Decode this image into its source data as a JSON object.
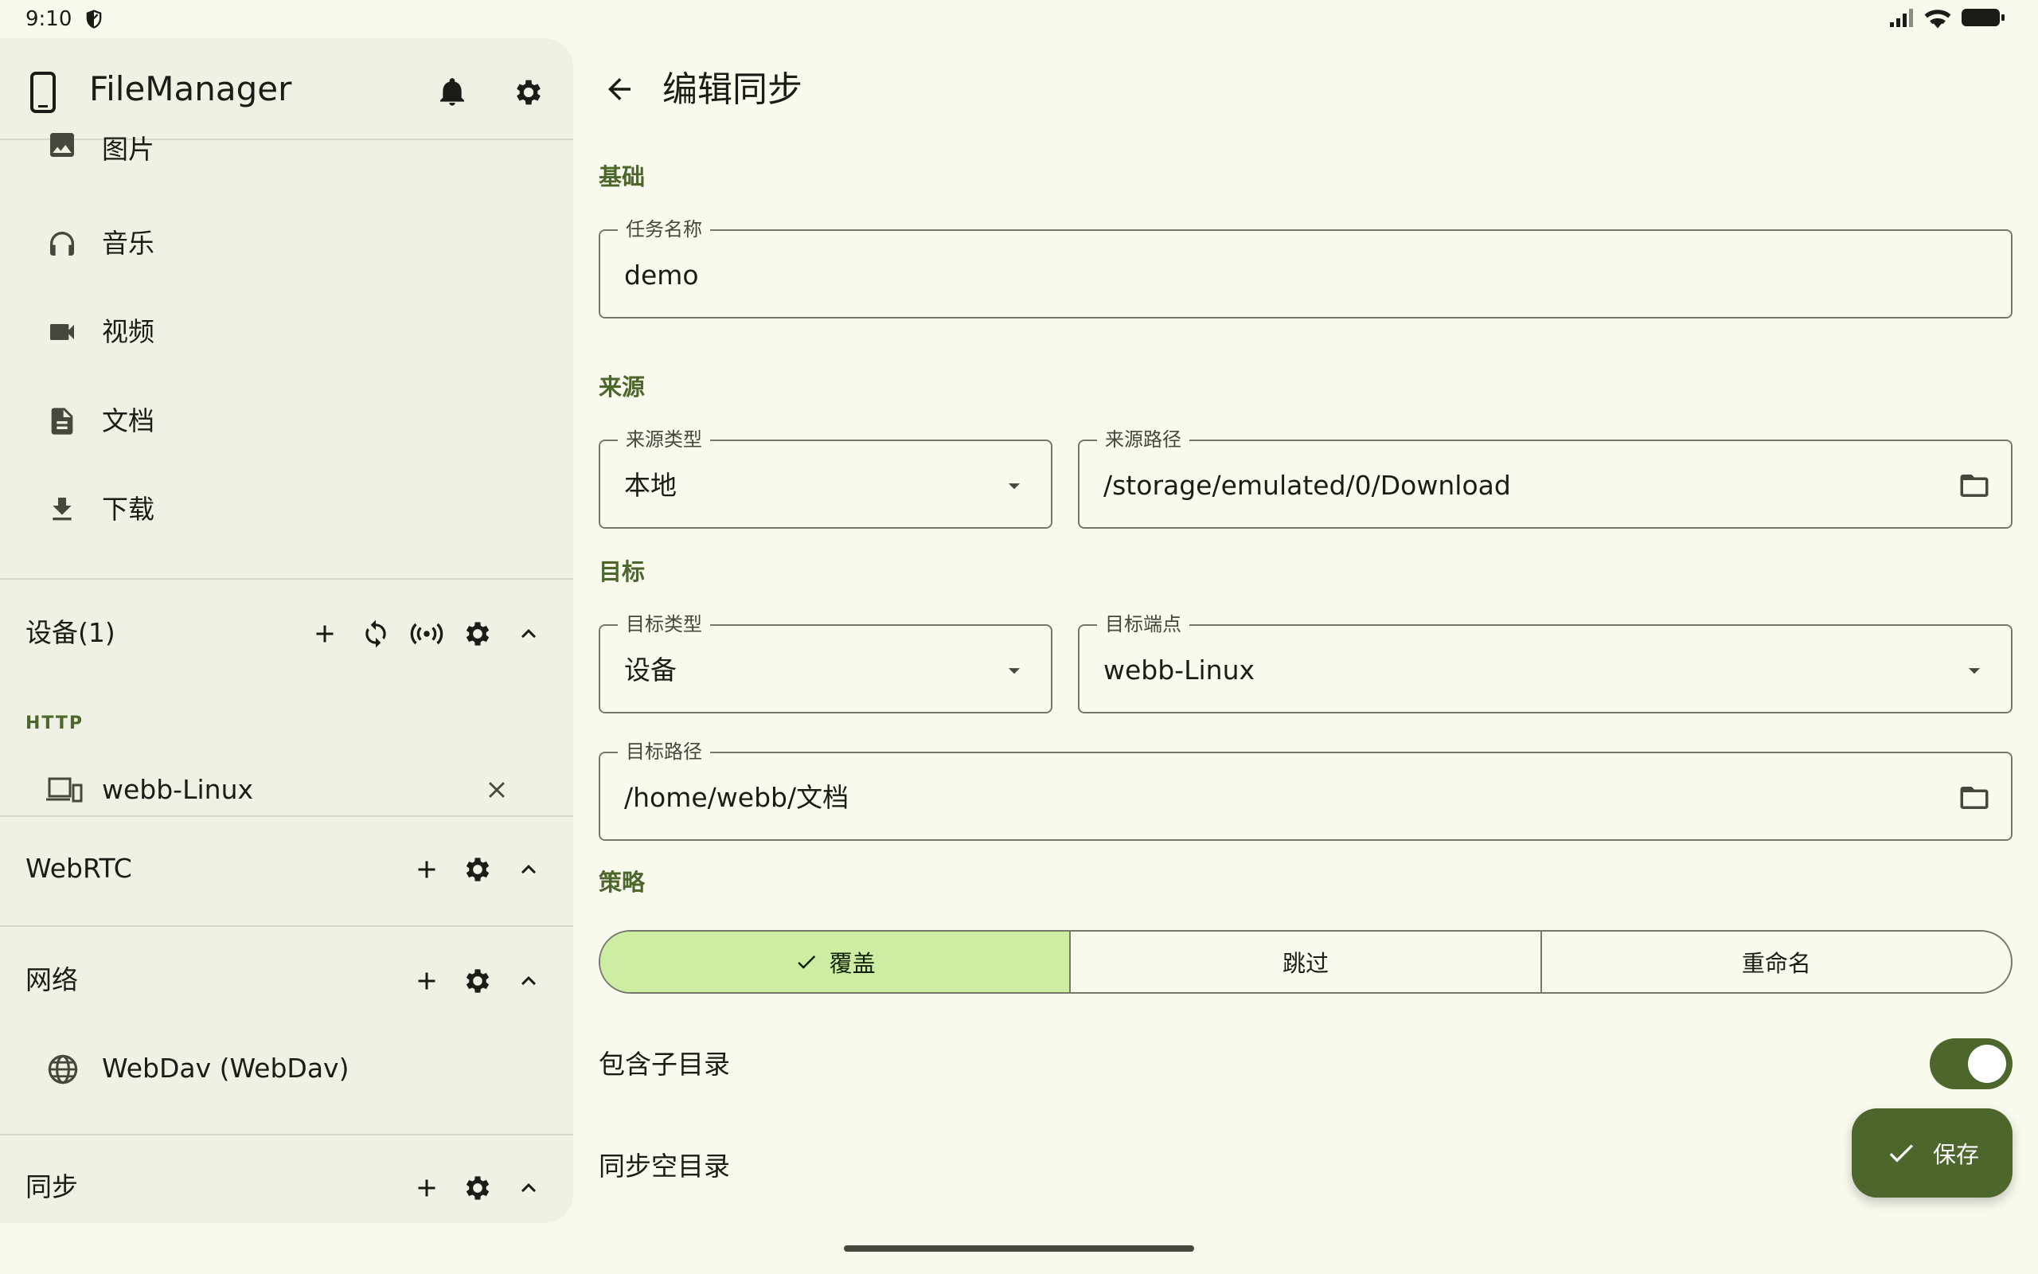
{
  "status": {
    "time": "9:10"
  },
  "app": {
    "title": "FileManager"
  },
  "nav": [
    {
      "label": "图片",
      "icon": "image-icon"
    },
    {
      "label": "音乐",
      "icon": "headphones-icon"
    },
    {
      "label": "视频",
      "icon": "videocam-icon"
    },
    {
      "label": "文档",
      "icon": "document-icon"
    },
    {
      "label": "下载",
      "icon": "download-icon"
    }
  ],
  "sections": {
    "devices": {
      "title": "设备(1)",
      "protocol": "HTTP",
      "items": [
        {
          "name": "webb-Linux"
        }
      ]
    },
    "webrtc": {
      "title": "WebRTC"
    },
    "network": {
      "title": "网络",
      "items": [
        {
          "name": "WebDav (WebDav)"
        }
      ]
    },
    "sync": {
      "title": "同步"
    }
  },
  "main": {
    "title": "编辑同步",
    "basic": {
      "section": "基础",
      "task_name_label": "任务名称",
      "task_name_value": "demo"
    },
    "source": {
      "section": "来源",
      "type_label": "来源类型",
      "type_value": "本地",
      "path_label": "来源路径",
      "path_value": "/storage/emulated/0/Download"
    },
    "target": {
      "section": "目标",
      "type_label": "目标类型",
      "type_value": "设备",
      "endpoint_label": "目标端点",
      "endpoint_value": "webb-Linux",
      "path_label": "目标路径",
      "path_value": "/home/webb/文档"
    },
    "strategy": {
      "section": "策略",
      "options": [
        "覆盖",
        "跳过",
        "重命名"
      ],
      "selected": "覆盖"
    },
    "include_subdirs": {
      "label": "包含子目录",
      "enabled": true
    },
    "sync_empty_dirs": {
      "label": "同步空目录"
    },
    "save_label": "保存"
  },
  "colors": {
    "background": "#f9faee",
    "sidebar": "#eff1e4",
    "accent": "#4c662b",
    "selected_segment": "#cdeda3",
    "outline": "#75796c"
  }
}
